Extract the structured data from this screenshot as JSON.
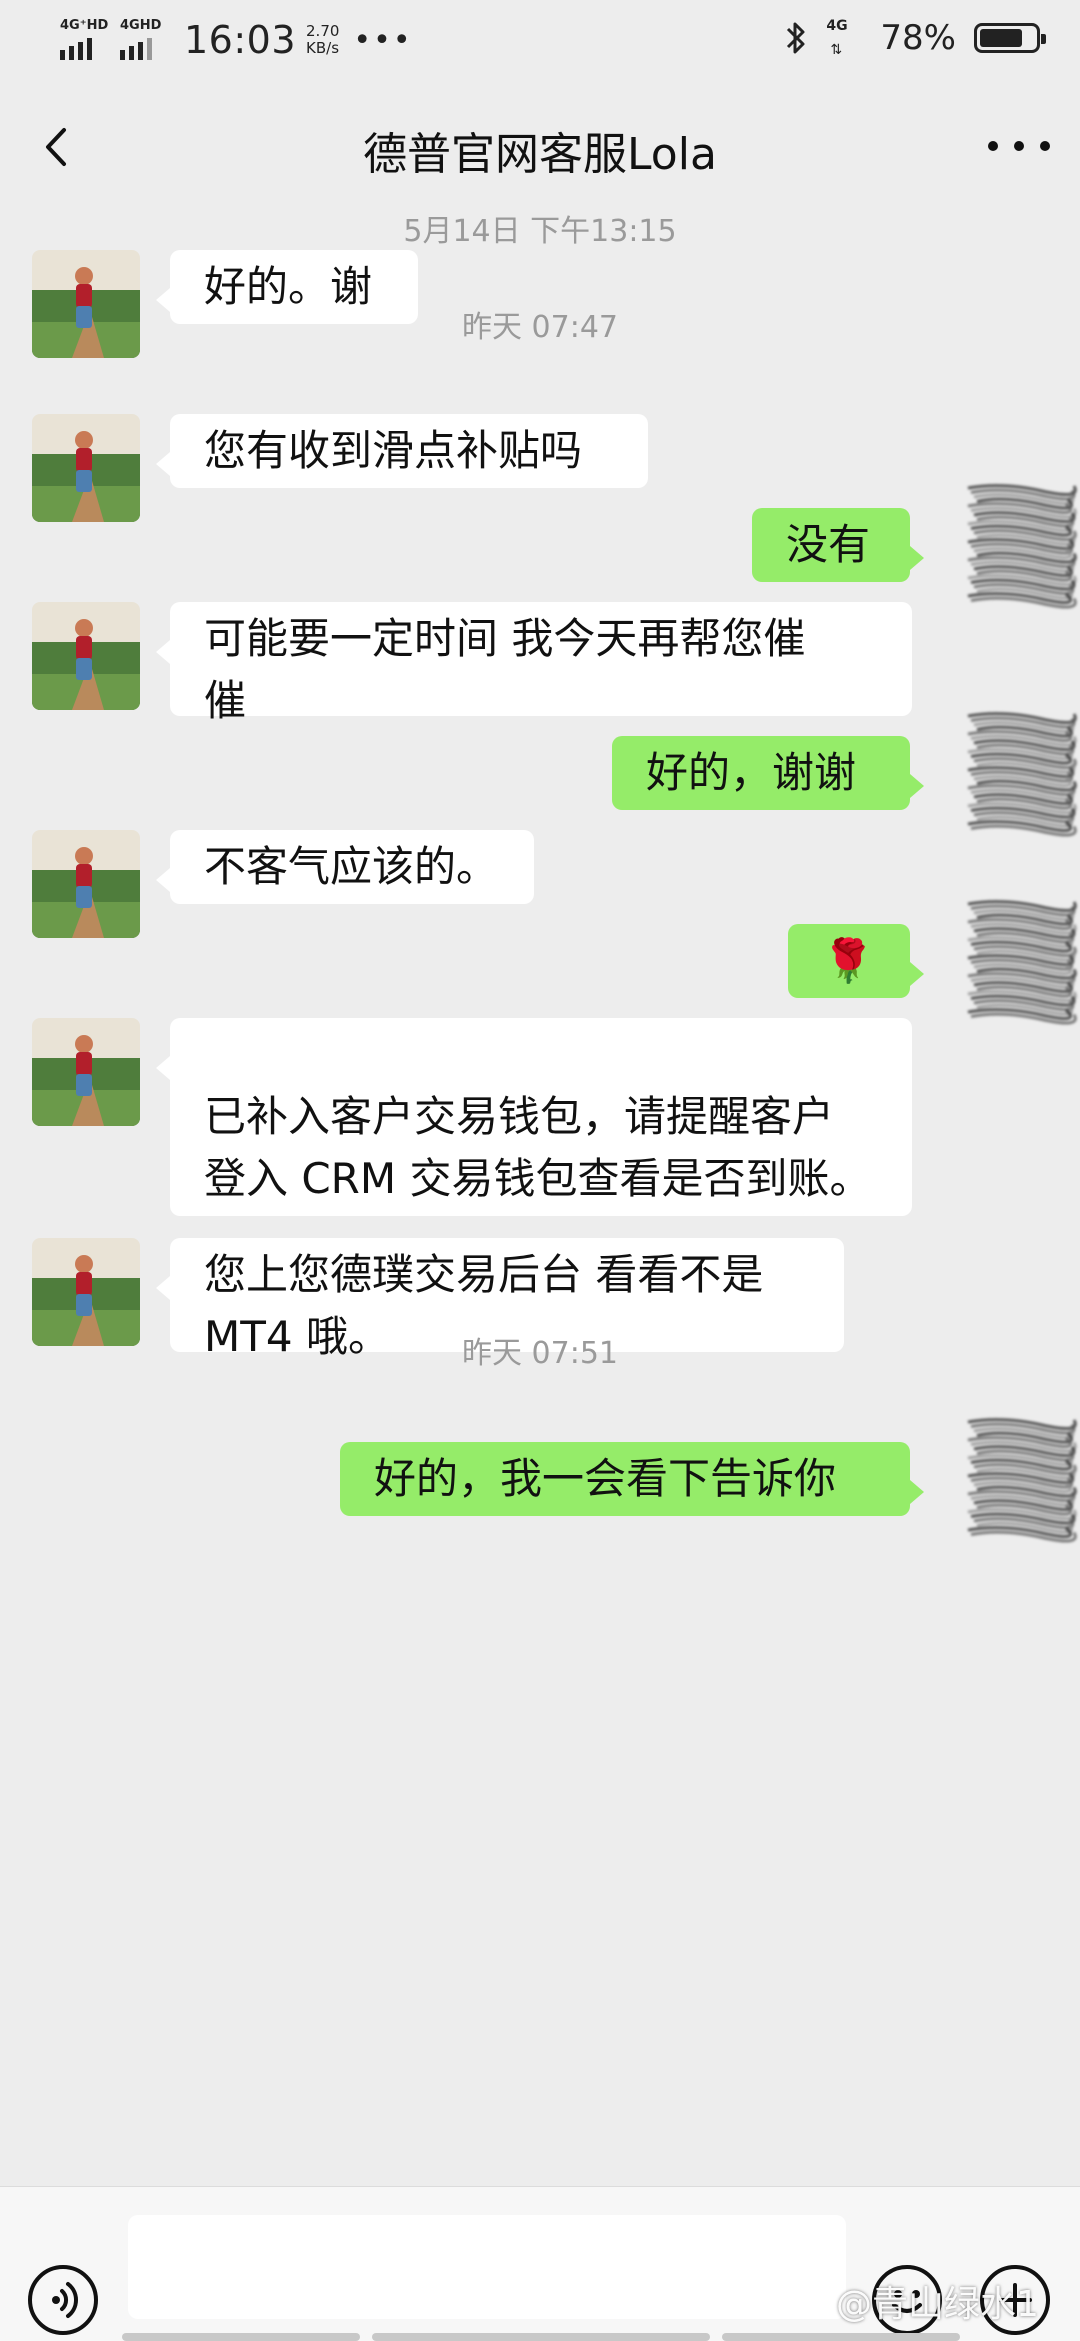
{
  "status_bar": {
    "network_1": "4G⁺HD",
    "network_2": "4GHD",
    "time": "16:03",
    "speed_value": "2.70",
    "speed_unit": "KB/s",
    "more_dots": "•••",
    "network_3": "4G",
    "battery_percent": "78%",
    "battery_level": 0.78
  },
  "header": {
    "title": "德普官网客服Lola"
  },
  "messages": [
    {
      "kind": "timestamp",
      "text": "5月14日 下午13:15"
    },
    {
      "kind": "in",
      "lines": [
        "好的。谢"
      ]
    },
    {
      "kind": "timestamp",
      "text": "昨天 07:47"
    },
    {
      "kind": "in",
      "lines": [
        "您有收到滑点补贴吗"
      ]
    },
    {
      "kind": "out",
      "lines": [
        "没有"
      ]
    },
    {
      "kind": "in",
      "lines": [
        "可能要一定时间 我今天再帮您催",
        "催"
      ]
    },
    {
      "kind": "out",
      "lines": [
        "好的，谢谢"
      ]
    },
    {
      "kind": "in",
      "lines": [
        "不客气应该的。"
      ]
    },
    {
      "kind": "out",
      "lines": [
        "🌹"
      ]
    },
    {
      "kind": "in",
      "lines": [
        "已补入客户交易钱包，请提醒客户",
        "登入 CRM 交易钱包查看是否到账。"
      ]
    },
    {
      "kind": "in",
      "lines": [
        "您上您德璞交易后台 看看不是",
        "MT4 哦。"
      ]
    },
    {
      "kind": "timestamp",
      "text": "昨天 07:51"
    },
    {
      "kind": "out",
      "lines": [
        "好的，我一会看下告诉你"
      ]
    }
  ],
  "input_bar": {
    "placeholder": "",
    "watermark": "@青山绿水1"
  },
  "colors": {
    "background": "#ededed",
    "outgoing_bubble": "#95ec69",
    "incoming_bubble": "#ffffff",
    "timestamp_text": "#9a9a9a"
  },
  "icons": {
    "back": "chevron-left-icon",
    "more": "more-dots-icon",
    "voice": "voice-icon",
    "emoji": "emoji-icon",
    "plus": "plus-icon",
    "bluetooth": "bluetooth-icon",
    "battery": "battery-icon"
  }
}
